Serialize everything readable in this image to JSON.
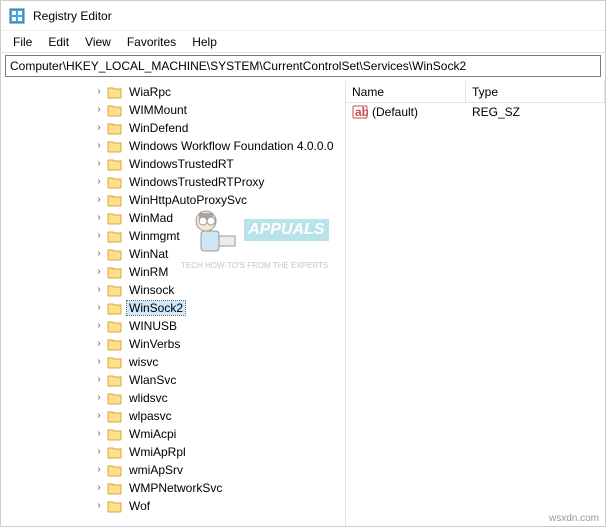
{
  "window": {
    "title": "Registry Editor"
  },
  "menubar": {
    "items": [
      "File",
      "Edit",
      "View",
      "Favorites",
      "Help"
    ]
  },
  "addressbar": {
    "path": "Computer\\HKEY_LOCAL_MACHINE\\SYSTEM\\CurrentControlSet\\Services\\WinSock2"
  },
  "tree": {
    "selected": "WinSock2",
    "items": [
      {
        "label": "WiaRpc"
      },
      {
        "label": "WIMMount"
      },
      {
        "label": "WinDefend"
      },
      {
        "label": "Windows Workflow Foundation 4.0.0.0"
      },
      {
        "label": "WindowsTrustedRT"
      },
      {
        "label": "WindowsTrustedRTProxy"
      },
      {
        "label": "WinHttpAutoProxySvc"
      },
      {
        "label": "WinMad"
      },
      {
        "label": "Winmgmt"
      },
      {
        "label": "WinNat"
      },
      {
        "label": "WinRM"
      },
      {
        "label": "Winsock"
      },
      {
        "label": "WinSock2"
      },
      {
        "label": "WINUSB"
      },
      {
        "label": "WinVerbs"
      },
      {
        "label": "wisvc"
      },
      {
        "label": "WlanSvc"
      },
      {
        "label": "wlidsvc"
      },
      {
        "label": "wlpasvc"
      },
      {
        "label": "WmiAcpi"
      },
      {
        "label": "WmiApRpl"
      },
      {
        "label": "wmiApSrv"
      },
      {
        "label": "WMPNetworkSvc"
      },
      {
        "label": "Wof"
      }
    ]
  },
  "details": {
    "columns": {
      "name": "Name",
      "type": "Type"
    },
    "rows": [
      {
        "name": "(Default)",
        "type": "REG_SZ",
        "icon": "string-value"
      }
    ]
  },
  "watermark": {
    "brand": "APPUALS",
    "tagline": "TECH HOW-TO'S FROM THE EXPERTS"
  },
  "source": "wsxdn.com",
  "icons": {
    "app": "registry-editor-icon",
    "folder": "folder-icon",
    "expander_collapsed": "›",
    "value_string": "ab"
  }
}
